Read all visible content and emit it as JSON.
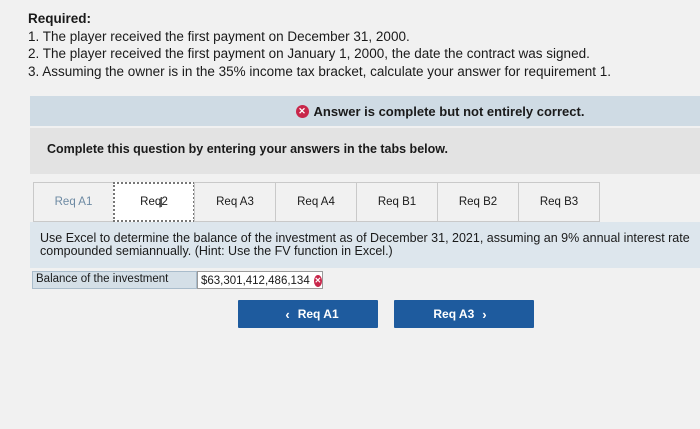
{
  "required": {
    "title": "Required:",
    "items": [
      "1. The player received the first payment on December 31, 2000.",
      "2. The player received the first payment on January 1, 2000, the date the contract was signed.",
      "3. Assuming the owner is in the 35% income tax bracket, calculate your answer for requirement 1."
    ]
  },
  "banner": {
    "text": "Answer is complete but not entirely correct."
  },
  "instructions": "Complete this question by entering your answers in the tabs below.",
  "tabs": [
    {
      "label": "Req A1"
    },
    {
      "label_pre": "Req ",
      "label_post": "2"
    },
    {
      "label": "Req A3"
    },
    {
      "label": "Req A4"
    },
    {
      "label": "Req B1"
    },
    {
      "label": "Req B2"
    },
    {
      "label": "Req B3"
    }
  ],
  "question": {
    "line1": "Use Excel to determine the balance of the investment as of December 31, 2021, assuming an 9% annual interest rate",
    "line2": "compounded semiannually. (Hint: Use the FV function in Excel.)"
  },
  "answer": {
    "label": "Balance of the investment",
    "value": "$63,301,412,486,134"
  },
  "nav": {
    "prev_label": "Req A1",
    "next_label": "Req A3"
  },
  "colors": {
    "error": "#c8264a",
    "nav_button": "#1e5b9e",
    "banner": "#cfdbe4"
  }
}
